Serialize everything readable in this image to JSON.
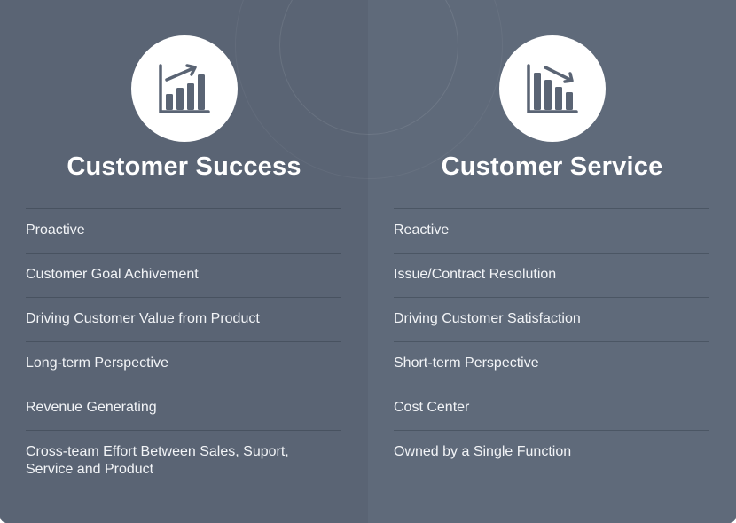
{
  "colors": {
    "left_panel_bg": "#5a6474",
    "right_panel_bg": "#5f6a7a",
    "icon_circle_bg": "#ffffff",
    "icon_color": "#5a6474",
    "text_color": "#ffffff"
  },
  "columns": [
    {
      "title": "Customer Success",
      "icon": "chart-trending-up-icon",
      "items": [
        "Proactive",
        "Customer Goal Achivement",
        "Driving Customer Value from Product",
        "Long-term Perspective",
        "Revenue Generating",
        "Cross-team Effort Between Sales, Suport, Service and Product"
      ]
    },
    {
      "title": "Customer Service",
      "icon": "chart-trending-down-icon",
      "items": [
        "Reactive",
        "Issue/Contract Resolution",
        "Driving Customer Satisfaction",
        "Short-term Perspective",
        "Cost Center",
        "Owned by a Single Function"
      ]
    }
  ]
}
